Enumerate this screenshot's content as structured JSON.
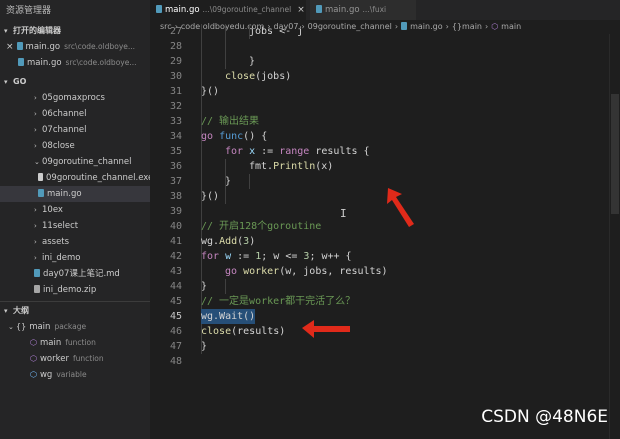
{
  "explorer": {
    "title": "资源管理器",
    "open_editors": {
      "header": "打开的编辑器",
      "items": [
        {
          "name": "main.go",
          "path": "src\\code.oldboye...",
          "close": "×"
        },
        {
          "name": "main.go",
          "path": "src\\code.oldboye..."
        }
      ]
    },
    "folder": {
      "header": "GO",
      "items": [
        {
          "label": "05gomaxprocs"
        },
        {
          "label": "06channel"
        },
        {
          "label": "07channel"
        },
        {
          "label": "08close"
        },
        {
          "label": "09goroutine_channel"
        },
        {
          "label": "09goroutine_channel.exe"
        },
        {
          "label": "main.go"
        },
        {
          "label": "10ex"
        },
        {
          "label": "11select"
        },
        {
          "label": "assets"
        },
        {
          "label": "ini_demo"
        },
        {
          "label": "day07课上笔记.md"
        },
        {
          "label": "ini_demo.zip"
        }
      ]
    },
    "outline": {
      "header": "大纲",
      "items": [
        {
          "name": "main",
          "kind": "package",
          "icon": "{}"
        },
        {
          "name": "main",
          "kind": "function",
          "icon": "⬡"
        },
        {
          "name": "worker",
          "kind": "function",
          "icon": "⬡"
        },
        {
          "name": "wg",
          "kind": "variable",
          "icon": "⬡"
        }
      ]
    }
  },
  "tabs": [
    {
      "name": "main.go",
      "desc": "...\\09goroutine_channel",
      "close": "×"
    },
    {
      "name": "main.go",
      "desc": "...\\fuxi"
    }
  ],
  "breadcrumb": [
    "src",
    "code.oldboyedu.com",
    "day07",
    "09goroutine_channel",
    "main.go",
    "{}main",
    "main"
  ],
  "line_numbers": [
    "27",
    "28",
    "29",
    "30",
    "31",
    "32",
    "33",
    "34",
    "35",
    "36",
    "37",
    "38",
    "39",
    "40",
    "41",
    "42",
    "43",
    "44",
    "45",
    "46",
    "47",
    "48"
  ],
  "current_line": "45",
  "code": {
    "l27": [
      "jobs <- j"
    ],
    "l29": "}",
    "l30_close": "close",
    "l30_args": "(jobs)",
    "l31": "}()",
    "l33": "// 输出结果",
    "l34_kw": "go",
    "l34_fn": "func",
    "l34_rest": "() {",
    "l35_for": "for",
    "l35_x": "x",
    "l35_op": " := ",
    "l35_range": "range",
    "l35_rest": " results {",
    "l36_pkg": "fmt.",
    "l36_fn": "Println",
    "l36_rest": "(x)",
    "l37": "}",
    "l38": "}()",
    "l40": "// 开启128个goroutine",
    "l41_obj": "wg.",
    "l41_fn": "Add",
    "l41_open": "(",
    "l41_num": "3",
    "l41_close": ")",
    "l42_for": "for",
    "l42_w": "w",
    "l42_mid": " := ",
    "l42_one": "1",
    "l42_mid2": "; w <= ",
    "l42_three": "3",
    "l42_end": "; w++ {",
    "l43_go": "go",
    "l43_fn": "worker",
    "l43_rest": "(w, jobs, results)",
    "l44": "}",
    "l45": "// 一定是worker都干完活了么？",
    "l46": "wg.Wait()",
    "l47_fn": "close",
    "l47_rest": "(results)",
    "l48": "}"
  },
  "watermark": "CSDN @48N6E",
  "colors": {
    "annotation_arrow": "#e02a1a",
    "selection": "#264f78"
  }
}
